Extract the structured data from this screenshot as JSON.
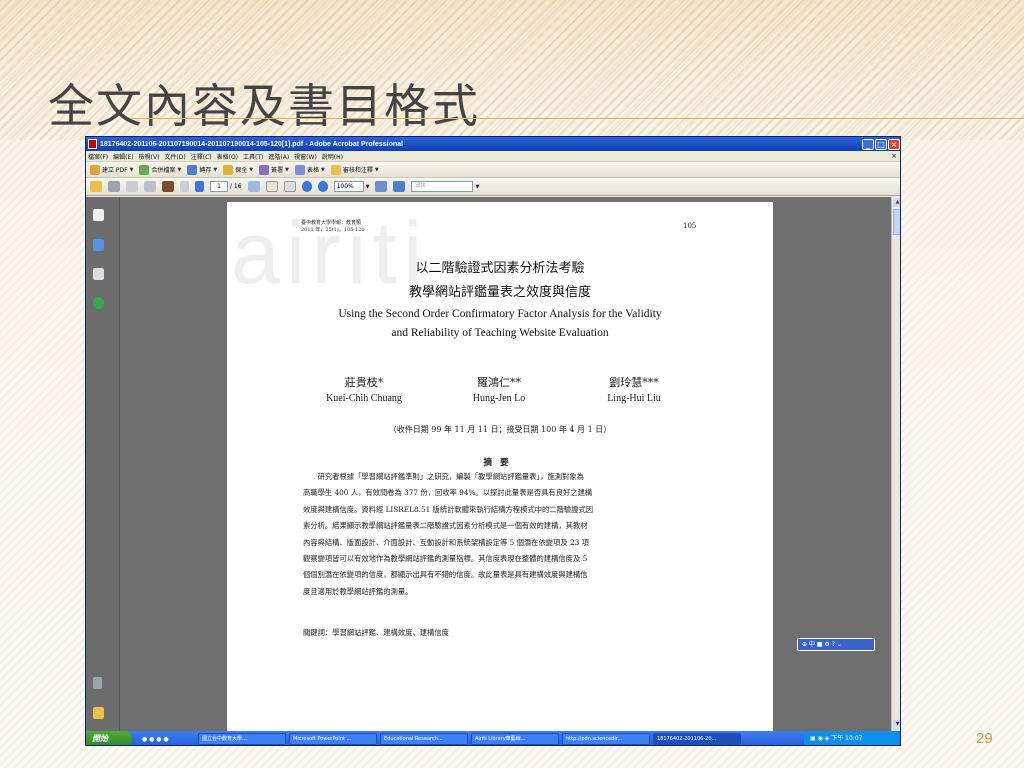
{
  "slide": {
    "title": "全文內容及書目格式",
    "number": "29"
  },
  "window": {
    "title": "18176402-201106-201107190014-201107190014-105-120[1].pdf - Adobe Acrobat Professional",
    "controls": [
      "_",
      "□",
      "×"
    ]
  },
  "menubar": {
    "items": [
      "檔案(F)",
      "編輯(E)",
      "檢視(V)",
      "文件(D)",
      "注釋(C)",
      "表格(O)",
      "工具(T)",
      "進階(A)",
      "視窗(W)",
      "說明(H)"
    ],
    "close": "×"
  },
  "toolbar": {
    "create_pdf": "建立 PDF",
    "combine": "合併檔案",
    "export": "轉存",
    "secure": "保全",
    "sign": "簽署",
    "forms": "表格",
    "review": "審核和注釋"
  },
  "toolbar2": {
    "page_current": "1",
    "page_total": "/ 16",
    "zoom": "100%",
    "find_placeholder": "尋找"
  },
  "document": {
    "watermark": "airiti",
    "journal_line1": "臺中教育大學學報：教育類",
    "journal_line2": "2011 年，25(1)，105-120",
    "page_number": "105",
    "cn_title_line1": "以二階驗證式因素分析法考驗",
    "cn_title_line2": "教學網站評鑑量表之效度與信度",
    "en_title_line1": "Using the Second Order Confirmatory Factor Analysis for the Validity",
    "en_title_line2": "and Reliability of Teaching Website Evaluation",
    "authors": [
      {
        "cn": "莊貴枝*",
        "en": "Kuei-Chih Chuang"
      },
      {
        "cn": "羅鴻仁**",
        "en": "Hung-Jen Lo"
      },
      {
        "cn": "劉玲慧***",
        "en": "Ling-Hui Liu"
      }
    ],
    "dates": "（收件日期 99 年 11 月 11 日；接受日期 100 年 4 月 1 日）",
    "abstract_heading": "摘要",
    "abstract_lines": [
      "　　研究者根據「學習網站評鑑準則」之研究，編製「教學網站評鑑量表」，施測對象為",
      "高職學生 400 人，有效問卷為 377 份，回收率 94%。以探討此量表是否具有良好之建構",
      "效度與建構信度。資料經 LISREL8.51 版統計軟體來執行結構方程模式中的二階驗證式因",
      "素分析。結果顯示教學網站評鑑量表二階驗證式因素分析模式是一個有效的建構，其教材",
      "內容與結構、版面設計、介面設計、互動設計和系統架構設定等 5 個潛在依變項及 23 項",
      "觀察變項皆可以有效地作為教學網站評鑑的測量指標。其信度表現在整體的建構信度及 5",
      "個個別潛在依變項的信度，都顯示出具有不錯的信度。故此量表是具有建構效度與建構信",
      "度且適用於教學網站評鑑的測量。"
    ],
    "keywords": "關鍵詞：學習網站評鑑、建構效度、建構信度"
  },
  "lang_bar": "⊕ 中 ■ ⚙ ? ⌄",
  "taskbar": {
    "start": "開始",
    "tasks": [
      "國立台中教育大學...",
      "Microsoft PowerPoint ...",
      "Educational Research...",
      "Airiti Library華藝線...",
      "http://pdn.sciencedir...",
      "18176402-201106-20..."
    ],
    "clock": "下午 10:07"
  },
  "colors": {
    "title_bar": "#0a3fb0",
    "taskbar": "#245edb",
    "start_button": "#2f8a26",
    "slide_accent": "#d39b3c"
  }
}
